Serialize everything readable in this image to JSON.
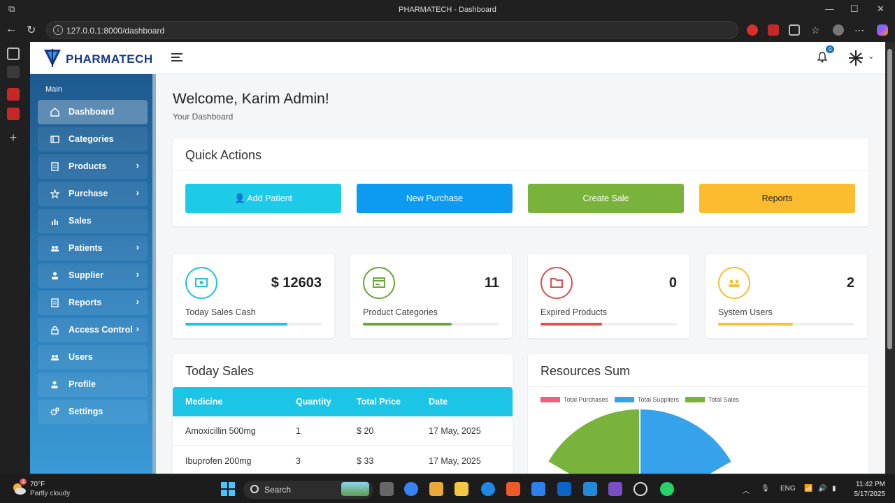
{
  "browser": {
    "title": "PHARMATECH - Dashboard",
    "url": "127.0.0.1:8000/dashboard"
  },
  "header": {
    "brand": "PHARMATECH",
    "notification_count": "0"
  },
  "sidebar": {
    "section": "Main",
    "items": [
      {
        "label": "Dashboard",
        "icon": "home-icon",
        "arrow": ""
      },
      {
        "label": "Categories",
        "icon": "list-icon",
        "arrow": ""
      },
      {
        "label": "Products",
        "icon": "document-icon",
        "arrow": "›"
      },
      {
        "label": "Purchase",
        "icon": "star-icon",
        "arrow": "›"
      },
      {
        "label": "Sales",
        "icon": "bar-chart-icon",
        "arrow": ""
      },
      {
        "label": "Patients",
        "icon": "users-icon",
        "arrow": "›"
      },
      {
        "label": "Supplier",
        "icon": "user-icon",
        "arrow": "›"
      },
      {
        "label": "Reports",
        "icon": "document-icon",
        "arrow": "›"
      },
      {
        "label": "Access Control",
        "icon": "lock-icon",
        "arrow": "›"
      },
      {
        "label": "Users",
        "icon": "users-icon",
        "arrow": ""
      },
      {
        "label": "Profile",
        "icon": "user-edit-icon",
        "arrow": ""
      },
      {
        "label": "Settings",
        "icon": "gears-icon",
        "arrow": ""
      }
    ]
  },
  "main": {
    "welcome": "Welcome, Karim Admin!",
    "subtitle": "Your Dashboard",
    "quick_actions": {
      "title": "Quick Actions",
      "buttons": [
        {
          "label": "Add Patient",
          "color": "#1ccbe8"
        },
        {
          "label": "New Purchase",
          "color": "#0d9bf2"
        },
        {
          "label": "Create Sale",
          "color": "#7ab33b"
        },
        {
          "label": "Reports",
          "color": "#fbbc2e"
        }
      ]
    },
    "stats": [
      {
        "value": "$ 12603",
        "label": "Today Sales Cash",
        "color": "#1cc4e6",
        "progress": 0.75
      },
      {
        "value": "11",
        "label": "Product Categories",
        "color": "#6aa83a",
        "progress": 0.65
      },
      {
        "value": "0",
        "label": "Expired Products",
        "color": "#d9534f",
        "progress": 0.45
      },
      {
        "value": "2",
        "label": "System Users",
        "color": "#f7c135",
        "progress": 0.55
      }
    ],
    "today_sales": {
      "title": "Today Sales",
      "columns": [
        "Medicine",
        "Quantity",
        "Total Price",
        "Date"
      ],
      "rows": [
        [
          "Amoxicillin 500mg",
          "1",
          "$ 20",
          "17 May, 2025"
        ],
        [
          "Ibuprofen 200mg",
          "3",
          "$ 33",
          "17 May, 2025"
        ]
      ]
    },
    "resources": {
      "title": "Resources Sum",
      "legend": [
        {
          "label": "Total Purchases",
          "color": "#f0607a"
        },
        {
          "label": "Total Suppliers",
          "color": "#36a2eb"
        },
        {
          "label": "Total Sales",
          "color": "#7ab33b"
        }
      ]
    }
  },
  "taskbar": {
    "weather_temp": "70°F",
    "weather_cond": "Partly cloudy",
    "weather_badge": "4",
    "search_placeholder": "Search",
    "lang": "ENG",
    "time": "11:42 PM",
    "date": "5/17/2025"
  }
}
